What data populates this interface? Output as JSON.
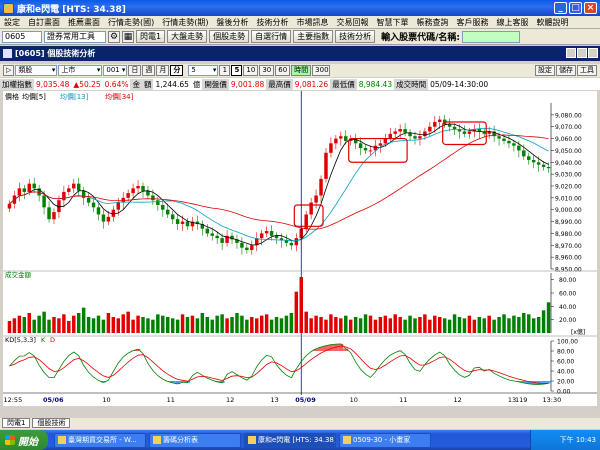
{
  "window": {
    "title": "康和e閃電 [HTS: 34.38]",
    "controls": {
      "minimize": "_",
      "maximize": "□",
      "close": "×"
    }
  },
  "menubar": [
    "設定",
    "自訂畫面",
    "推薦畫面",
    "行情走勢(國)",
    "行情走勢(期)",
    "盤後分析",
    "技術分析",
    "市場訊息",
    "交易回報",
    "智慧下單",
    "帳務查詢",
    "客戶服務",
    "線上客服",
    "軟體說明"
  ],
  "toolbar": {
    "code_value": "0605",
    "tool_select": "證券常用工具",
    "buttons": [
      "閃電1",
      "大盤走勢",
      "個股走勢",
      "自選行情",
      "主要指數",
      "技術分析"
    ],
    "stock_input_label": "輸入股票代碼/名稱:"
  },
  "panel": {
    "title": "[0605] 個股技術分析",
    "right_buttons": [
      "設定",
      "儲存",
      "工具"
    ]
  },
  "controls": {
    "market": "類股",
    "listing": "上市",
    "code": "001",
    "periods": [
      "日",
      "週",
      "月",
      "分"
    ],
    "minute_value": "5",
    "steps": [
      "1",
      "5",
      "10",
      "30",
      "60"
    ],
    "active_step": "5",
    "span_label": "時間",
    "count": "300"
  },
  "info": {
    "name": "加權指數",
    "price": "9,035.48",
    "change": "▲50.25",
    "pct": "0.64%",
    "amount_label": "金",
    "amount_value": "額",
    "volume": "1,244.65",
    "unit": "億",
    "open_label": "開盤價",
    "open": "9,001.88",
    "high_label": "最高價",
    "high": "9,081.26",
    "low_label": "最低價",
    "low": "8,984.43",
    "time_label": "成交時間",
    "time": "05/09-14:30:00"
  },
  "chart_data": {
    "type": "candlestick",
    "panels": [
      {
        "name": "price",
        "legend": [
          {
            "name": "價格",
            "color": "#000000"
          },
          {
            "name": "均價[5]",
            "color": "#000000"
          },
          {
            "name": "均價[13]",
            "color": "#00a0c8"
          },
          {
            "name": "均價[34]",
            "color": "#e00000"
          }
        ],
        "ylim": [
          8950,
          9090
        ],
        "y_ticks": [
          "9,080.00",
          "9,070.00",
          "9,060.00",
          "9,050.00",
          "9,040.00",
          "9,030.00",
          "9,020.00",
          "9,010.00",
          "9,000.00",
          "8,990.00",
          "8,980.00",
          "8,970.00",
          "8,960.00",
          "8,950.00"
        ],
        "close": [
          9005,
          9012,
          9018,
          9015,
          9022,
          9018,
          9012,
          9002,
          8992,
          8998,
          9008,
          9015,
          9018,
          9022,
          9016,
          9010,
          9006,
          9002,
          8996,
          8990,
          8994,
          9000,
          9006,
          9010,
          9014,
          9018,
          9020,
          9016,
          9012,
          9008,
          9004,
          9000,
          8996,
          8992,
          8988,
          8990,
          8986,
          8990,
          8988,
          8984,
          8980,
          8978,
          8976,
          8972,
          8978,
          8975,
          8972,
          8968,
          8966,
          8970,
          8976,
          8980,
          8982,
          8978,
          8976,
          8974,
          8972,
          8970,
          8976,
          8984,
          8996,
          9006,
          9012,
          9026,
          9048,
          9056,
          9060,
          9062,
          9058,
          9060,
          9056,
          9052,
          9050,
          9050,
          9054,
          9056,
          9060,
          9064,
          9066,
          9068,
          9065,
          9062,
          9060,
          9062,
          9066,
          9070,
          9074,
          9076,
          9072,
          9070,
          9068,
          9066,
          9064,
          9066,
          9068,
          9066,
          9064,
          9066,
          9062,
          9060,
          9058,
          9056,
          9054,
          9050,
          9045,
          9042,
          9040,
          9038,
          9036,
          9035
        ],
        "annotations": [
          "box near 05/09 open",
          "box near 9,050",
          "box near 9,060"
        ]
      },
      {
        "name": "成交金額",
        "y_ticks": [
          "80.00",
          "60.00",
          "40.00",
          "20.00"
        ],
        "unit": "[x億]",
        "values": [
          18,
          22,
          26,
          24,
          30,
          20,
          26,
          32,
          20,
          24,
          22,
          28,
          18,
          26,
          30,
          38,
          24,
          22,
          26,
          20,
          30,
          24,
          22,
          28,
          32,
          20,
          26,
          24,
          22,
          20,
          28,
          26,
          24,
          22,
          20,
          28,
          24,
          26,
          22,
          30,
          24,
          20,
          26,
          28,
          22,
          24,
          30,
          26,
          20,
          24,
          22,
          26,
          28,
          20,
          24,
          22,
          26,
          30,
          62,
          84,
          32,
          22,
          26,
          24,
          20,
          28,
          24,
          22,
          26,
          20,
          24,
          22,
          28,
          26,
          20,
          24,
          26,
          22,
          28,
          24,
          20,
          26,
          22,
          24,
          28,
          20,
          26,
          24,
          22,
          20,
          28,
          24,
          22,
          26,
          20,
          24,
          22,
          26,
          20,
          24,
          28,
          22,
          26,
          24,
          30,
          28,
          22,
          24,
          34,
          46
        ]
      },
      {
        "name": "KD[5,3,3]",
        "legend": [
          {
            "name": "K",
            "color": "#008000"
          },
          {
            "name": "D",
            "color": "#e00000"
          }
        ],
        "y_ticks": [
          "100.00",
          "80.00",
          "60.00",
          "40.00",
          "20.00",
          "0.00"
        ],
        "ylim": [
          0,
          100
        ]
      }
    ],
    "x_ticks": [
      "12:55",
      "05/06",
      "10",
      "11",
      "12",
      "13",
      "05/09",
      "10",
      "11",
      "12",
      "13",
      "13:30"
    ],
    "scroll_value": "119"
  },
  "dock_tabs": [
    "閃電1",
    "個股技術"
  ],
  "taskbar": {
    "start": "開始",
    "tasks": [
      "臺灣期貨交易所 - W...",
      "籌碼分析表",
      "康和e閃電 [HTS: 34.38]",
      "0509-30 - 小畫家"
    ],
    "clock": "下午 10:43"
  }
}
